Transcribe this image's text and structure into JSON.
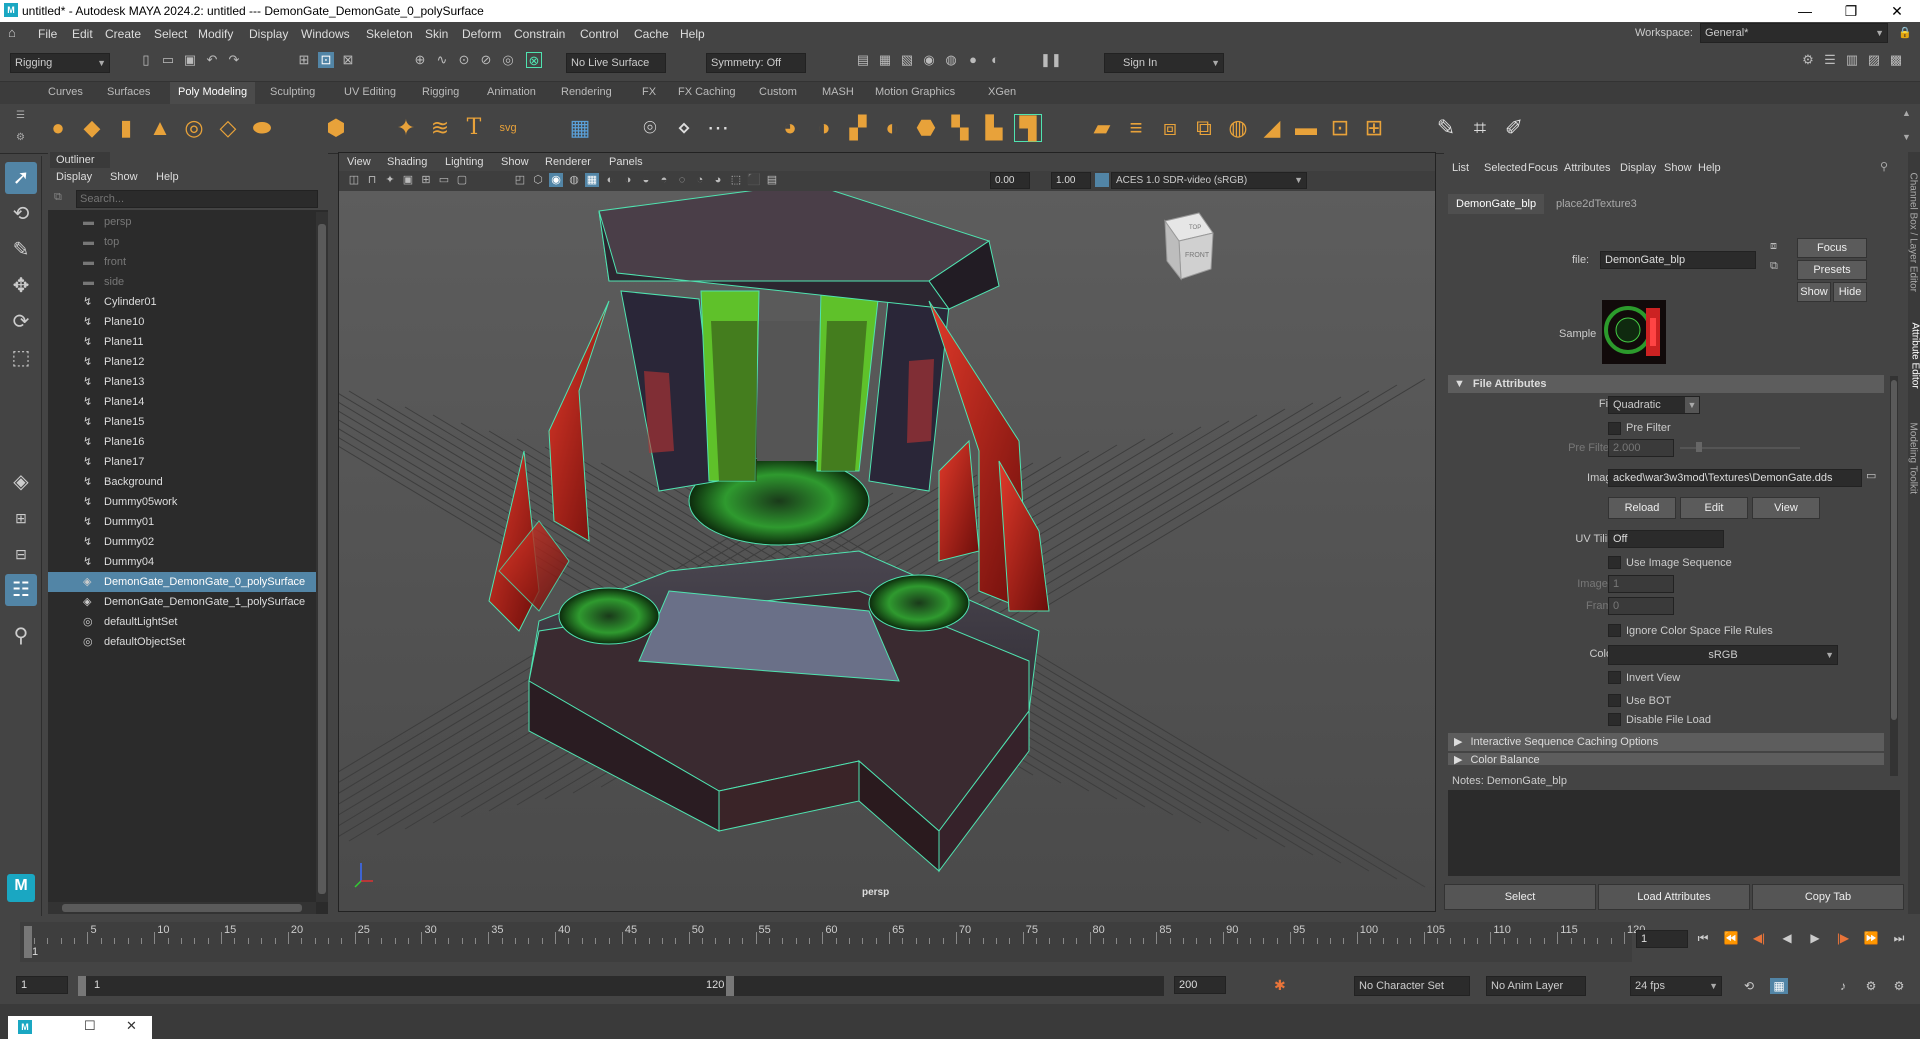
{
  "window": {
    "title": "untitled* - Autodesk MAYA 2024.2: untitled   ---   DemonGate_DemonGate_0_polySurface",
    "min": "—",
    "max": "❐",
    "close": "✕"
  },
  "menu": [
    "File",
    "Edit",
    "Create",
    "Select",
    "Modify",
    "Display",
    "Windows",
    "Skeleton",
    "Skin",
    "Deform",
    "Constrain",
    "Control",
    "Cache",
    "Help"
  ],
  "workspace": {
    "label": "Workspace:",
    "value": "General*"
  },
  "status": {
    "menuset": "Rigging",
    "live_surface": "No Live Surface",
    "symmetry": "Symmetry: Off",
    "sign_in": "Sign In"
  },
  "shelf_tabs": [
    "Curves",
    "Surfaces",
    "Poly Modeling",
    "Sculpting",
    "UV Editing",
    "Rigging",
    "Animation",
    "Rendering",
    "FX",
    "FX Caching",
    "Custom",
    "MASH",
    "Motion Graphics",
    "XGen"
  ],
  "shelf_active": "Poly Modeling",
  "outliner": {
    "title": "Outliner",
    "menu": [
      "Display",
      "Show",
      "Help"
    ],
    "search_placeholder": "Search...",
    "items": [
      {
        "label": "persp",
        "icon": "camera-icon",
        "dim": true
      },
      {
        "label": "top",
        "icon": "camera-icon",
        "dim": true
      },
      {
        "label": "front",
        "icon": "camera-icon",
        "dim": true
      },
      {
        "label": "side",
        "icon": "camera-icon",
        "dim": true
      },
      {
        "label": "Cylinder01",
        "icon": "curve-icon"
      },
      {
        "label": "Plane10",
        "icon": "curve-icon"
      },
      {
        "label": "Plane11",
        "icon": "curve-icon"
      },
      {
        "label": "Plane12",
        "icon": "curve-icon"
      },
      {
        "label": "Plane13",
        "icon": "curve-icon"
      },
      {
        "label": "Plane14",
        "icon": "curve-icon"
      },
      {
        "label": "Plane15",
        "icon": "curve-icon"
      },
      {
        "label": "Plane16",
        "icon": "curve-icon"
      },
      {
        "label": "Plane17",
        "icon": "curve-icon"
      },
      {
        "label": "Background",
        "icon": "curve-icon"
      },
      {
        "label": "Dummy05work",
        "icon": "curve-icon"
      },
      {
        "label": "Dummy01",
        "icon": "curve-icon"
      },
      {
        "label": "Dummy02",
        "icon": "curve-icon"
      },
      {
        "label": "Dummy04",
        "icon": "curve-icon"
      },
      {
        "label": "DemonGate_DemonGate_0_polySurface",
        "icon": "mesh-icon",
        "selected": true
      },
      {
        "label": "DemonGate_DemonGate_1_polySurface",
        "icon": "mesh-icon"
      },
      {
        "label": "defaultLightSet",
        "icon": "set-icon"
      },
      {
        "label": "defaultObjectSet",
        "icon": "set-icon"
      }
    ]
  },
  "viewport": {
    "menu": [
      "View",
      "Shading",
      "Lighting",
      "Show",
      "Renderer",
      "Panels"
    ],
    "near": "0.00",
    "far": "1.00",
    "colorspace": "ACES 1.0 SDR-video (sRGB)",
    "camera": "persp",
    "cube_top": "TOP",
    "cube_front": "FRONT"
  },
  "attr": {
    "menu": [
      "List",
      "Selected",
      "Focus",
      "Attributes",
      "Display",
      "Show",
      "Help"
    ],
    "tabs": [
      "DemonGate_blp",
      "place2dTexture3"
    ],
    "file_label": "file:",
    "file_value": "DemonGate_blp",
    "focus": "Focus",
    "presets": "Presets",
    "show": "Show",
    "hide": "Hide",
    "sample": "Sample",
    "section_file": "File Attributes",
    "filter_type_label": "Filter Type",
    "filter_type": "Quadratic",
    "pre_filter": "Pre Filter",
    "pre_filter_radius_label": "Pre Filter Radius",
    "pre_filter_radius": "2.000",
    "image_name_label": "Image Name",
    "image_name": "acked\\war3w3mod\\Textures\\DemonGate.dds",
    "reload": "Reload",
    "edit": "Edit",
    "view": "View",
    "uv_tiling_label": "UV Tiling Mode",
    "uv_tiling": "Off",
    "use_image_seq": "Use Image Sequence",
    "image_number_label": "Image Number",
    "image_number": "1",
    "frame_offset_label": "Frame Offset",
    "frame_offset": "0",
    "ignore_cs": "Ignore Color Space File Rules",
    "color_space_label": "Color Space",
    "color_space": "sRGB",
    "invert_view": "Invert View",
    "use_bot": "Use BOT",
    "disable_load": "Disable File Load",
    "section_interactive": "Interactive Sequence Caching Options",
    "section_color": "Color Balance",
    "notes": "Notes:  DemonGate_blp",
    "btn_select": "Select",
    "btn_load": "Load Attributes",
    "btn_copy": "Copy Tab",
    "side_tabs": [
      "Channel Box / Layer Editor",
      "Attribute Editor",
      "Modeling Toolkit"
    ]
  },
  "timeline": {
    "ticks": [
      "5",
      "10",
      "15",
      "20",
      "25",
      "30",
      "35",
      "40",
      "45",
      "50",
      "55",
      "60",
      "65",
      "70",
      "75",
      "80",
      "85",
      "90",
      "95",
      "100",
      "105",
      "110",
      "115",
      "120"
    ],
    "start_label": "1",
    "current_frame": "1"
  },
  "range": {
    "start": "1",
    "inner_start": "1",
    "inner_end": "120",
    "end": "200",
    "char_set": "No Character Set",
    "anim_layer": "No Anim Layer",
    "fps": "24 fps"
  },
  "colors": {
    "accent": "#5285a6",
    "wire": "#4fe3b0",
    "red": "#c0241c"
  }
}
